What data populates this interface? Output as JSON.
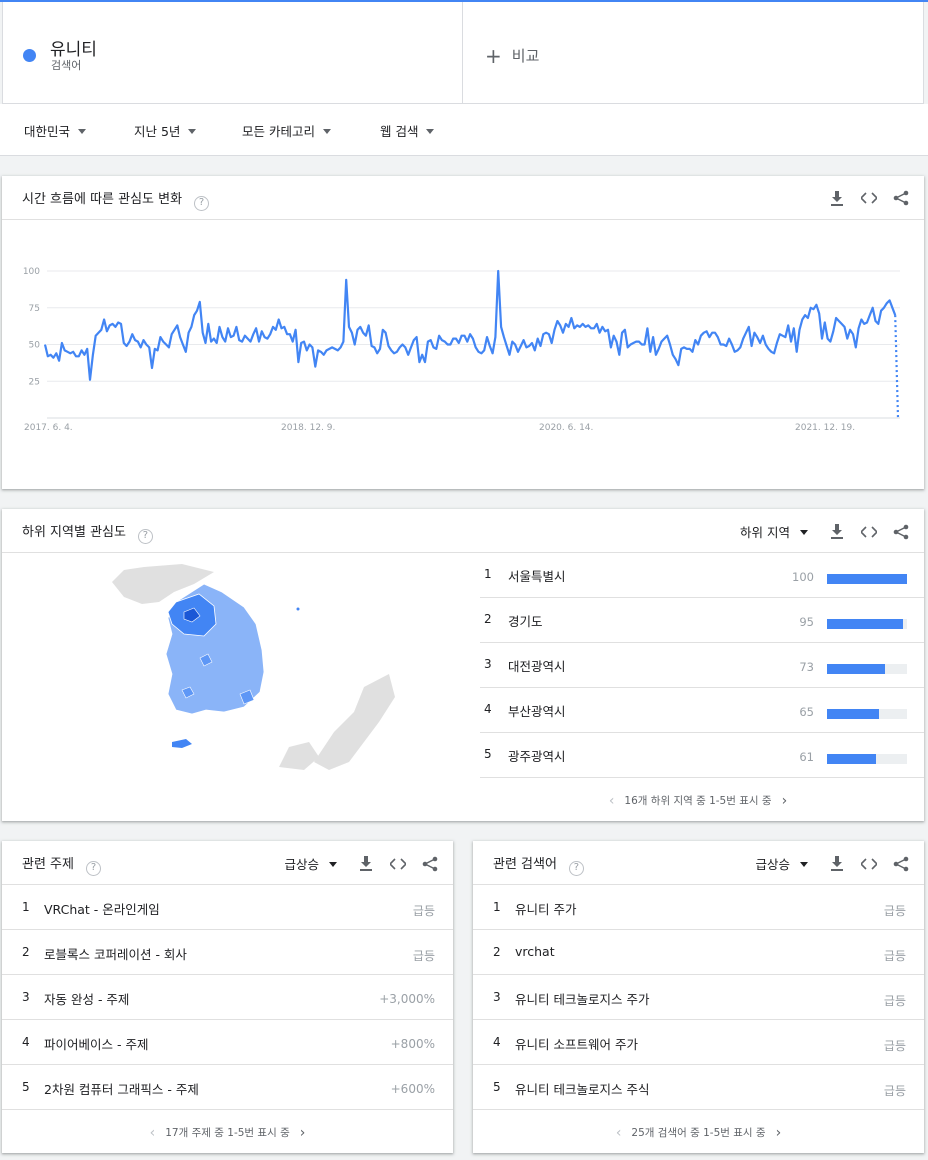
{
  "term": {
    "name": "유니티",
    "type": "검색어",
    "color": "#4285f4"
  },
  "compare": {
    "label": "비교"
  },
  "filters": [
    "대한민국",
    "지난 5년",
    "모든 카테고리",
    "웹 검색"
  ],
  "timeline": {
    "title": "시간 흐름에 따른 관심도 변화",
    "help": "?"
  },
  "chart_data": {
    "type": "line",
    "series": [
      {
        "color": "#4285f4"
      }
    ],
    "ylim": [
      0,
      100
    ],
    "yticks": [
      "100",
      "75",
      "50",
      "25"
    ],
    "xticks": [
      "2017. 6. 4.",
      "2018. 12. 9.",
      "2020. 6. 14.",
      "2021. 12. 19."
    ],
    "grid": true,
    "partial_last_point": true,
    "values": [
      50,
      42,
      43,
      41,
      44,
      39,
      51,
      46,
      45,
      44,
      45,
      42,
      42,
      46,
      43,
      47,
      26,
      43,
      56,
      58,
      60,
      67,
      59,
      63,
      64,
      62,
      65,
      64,
      51,
      49,
      52,
      57,
      53,
      52,
      48,
      53,
      50,
      48,
      34,
      47,
      46,
      55,
      52,
      50,
      48,
      57,
      60,
      63,
      55,
      50,
      45,
      58,
      62,
      70,
      73,
      79,
      58,
      51,
      64,
      52,
      54,
      51,
      62,
      55,
      52,
      61,
      55,
      56,
      62,
      53,
      52,
      56,
      54,
      52,
      57,
      61,
      52,
      59,
      55,
      54,
      57,
      62,
      60,
      67,
      61,
      62,
      57,
      57,
      52,
      60,
      38,
      51,
      52,
      46,
      50,
      48,
      35,
      46,
      45,
      43,
      46,
      47,
      48,
      47,
      46,
      48,
      52,
      94,
      62,
      58,
      50,
      60,
      62,
      58,
      56,
      63,
      49,
      48,
      44,
      47,
      60,
      58,
      49,
      46,
      44,
      45,
      48,
      50,
      48,
      43,
      48,
      53,
      55,
      38,
      43,
      38,
      52,
      53,
      48,
      47,
      56,
      53,
      52,
      50,
      50,
      54,
      54,
      51,
      56,
      56,
      52,
      57,
      54,
      48,
      45,
      44,
      46,
      55,
      49,
      44,
      55,
      100,
      62,
      55,
      49,
      43,
      52,
      50,
      45,
      49,
      53,
      48,
      49,
      51,
      46,
      54,
      49,
      57,
      58,
      57,
      51,
      60,
      66,
      63,
      58,
      64,
      62,
      68,
      61,
      63,
      62,
      64,
      62,
      63,
      61,
      61,
      64,
      58,
      62,
      59,
      60,
      48,
      56,
      52,
      43,
      58,
      60,
      48,
      50,
      51,
      52,
      52,
      50,
      50,
      61,
      45,
      55,
      43,
      47,
      52,
      54,
      56,
      50,
      43,
      40,
      36,
      47,
      48,
      47,
      47,
      45,
      53,
      50,
      56,
      58,
      59,
      55,
      58,
      58,
      55,
      50,
      50,
      49,
      54,
      50,
      45,
      46,
      48,
      54,
      58,
      62,
      49,
      58,
      55,
      51,
      56,
      50,
      47,
      45,
      44,
      51,
      57,
      56,
      55,
      63,
      52,
      61,
      45,
      60,
      67,
      70,
      68,
      75,
      74,
      77,
      71,
      54,
      65,
      54,
      52,
      59,
      68,
      66,
      64,
      62,
      54,
      60,
      57,
      48,
      61,
      67,
      64,
      65,
      70,
      75,
      66,
      64,
      73,
      75,
      78,
      80,
      75,
      70,
      0
    ]
  },
  "region": {
    "title": "하위 지역별 관심도",
    "help": "?",
    "select": "하위 지역",
    "rows": [
      {
        "rank": "1",
        "name": "서울특별시",
        "value": "100",
        "pct": 100
      },
      {
        "rank": "2",
        "name": "경기도",
        "value": "95",
        "pct": 95
      },
      {
        "rank": "3",
        "name": "대전광역시",
        "value": "73",
        "pct": 73
      },
      {
        "rank": "4",
        "name": "부산광역시",
        "value": "65",
        "pct": 65
      },
      {
        "rank": "5",
        "name": "광주광역시",
        "value": "61",
        "pct": 61
      }
    ],
    "pager": "16개 하위 지역 중 1-5번 표시 중"
  },
  "topics": {
    "title": "관련 주제",
    "help": "?",
    "select": "급상승",
    "rows": [
      {
        "rank": "1",
        "name": "VRChat - 온라인게임",
        "value": "급등"
      },
      {
        "rank": "2",
        "name": "로블록스 코퍼레이션 - 회사",
        "value": "급등"
      },
      {
        "rank": "3",
        "name": "자동 완성 - 주제",
        "value": "+3,000%"
      },
      {
        "rank": "4",
        "name": "파이어베이스 - 주제",
        "value": "+800%"
      },
      {
        "rank": "5",
        "name": "2차원 컴퓨터 그래픽스 - 주제",
        "value": "+600%"
      }
    ],
    "pager": "17개 주제 중 1-5번 표시 중"
  },
  "queries": {
    "title": "관련 검색어",
    "help": "?",
    "select": "급상승",
    "rows": [
      {
        "rank": "1",
        "name": "유니티 주가",
        "value": "급등"
      },
      {
        "rank": "2",
        "name": "vrchat",
        "value": "급등"
      },
      {
        "rank": "3",
        "name": "유니티 테크놀로지스 주가",
        "value": "급등"
      },
      {
        "rank": "4",
        "name": "유니티 소프트웨어 주가",
        "value": "급등"
      },
      {
        "rank": "5",
        "name": "유니티 테크놀로지스 주식",
        "value": "급등"
      }
    ],
    "pager": "25개 검색어 중 1-5번 표시 중"
  },
  "icons": {
    "download": "download-icon",
    "embed": "embed-icon",
    "share": "share-icon"
  }
}
